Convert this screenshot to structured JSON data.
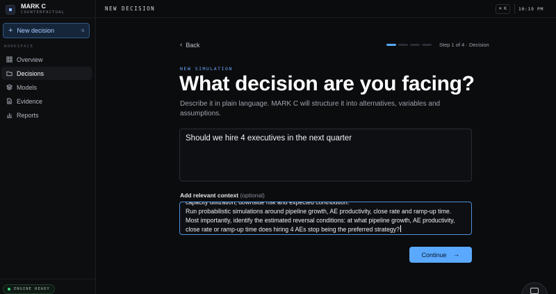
{
  "brand": {
    "name": "MARK C",
    "subtitle": "COUNTERFACTUAL"
  },
  "sidebar": {
    "new_button": {
      "label": "New decision",
      "shortcut": "N"
    },
    "section_label": "WORKSPACE",
    "items": [
      {
        "label": "Overview",
        "icon": "grid-icon",
        "active": false
      },
      {
        "label": "Decisions",
        "icon": "folder-icon",
        "active": true
      },
      {
        "label": "Models",
        "icon": "layers-icon",
        "active": false
      },
      {
        "label": "Evidence",
        "icon": "file-icon",
        "active": false
      },
      {
        "label": "Reports",
        "icon": "bar-chart-icon",
        "active": false
      }
    ],
    "engine_status": "ENGINE READY",
    "engine_status_color": "#3ddc84"
  },
  "topbar": {
    "title": "NEW DECISION",
    "command_shortcut": "⌘ K",
    "clock": "10:19 PM"
  },
  "main": {
    "back_label": "Back",
    "step": {
      "current": 1,
      "total": 4,
      "label": "Step 1 of 4 · Decision"
    },
    "eyebrow": "NEW SIMULATION",
    "title": "What decision are you facing?",
    "description": "Describe it in plain language. MARK C will structure it into alternatives, variables and assumptions.",
    "decision_value": "Should we hire 4 executives in the next quarter",
    "context_label": "Add relevant context",
    "context_optional": "(optional)",
    "context_lines": [
      "capacity utilization, downside risk and expected contribution.",
      "Run probabilistic simulations around pipeline growth, AE productivity, close rate and ramp-up time.",
      "Most importantly, identify the estimated reversal conditions: at what pipeline growth, AE productivity,",
      "close rate or ramp-up time does hiring 4 AEs stop being the preferred strategy?"
    ],
    "continue_label": "Continue",
    "accent_color": "#5aa9ff"
  }
}
